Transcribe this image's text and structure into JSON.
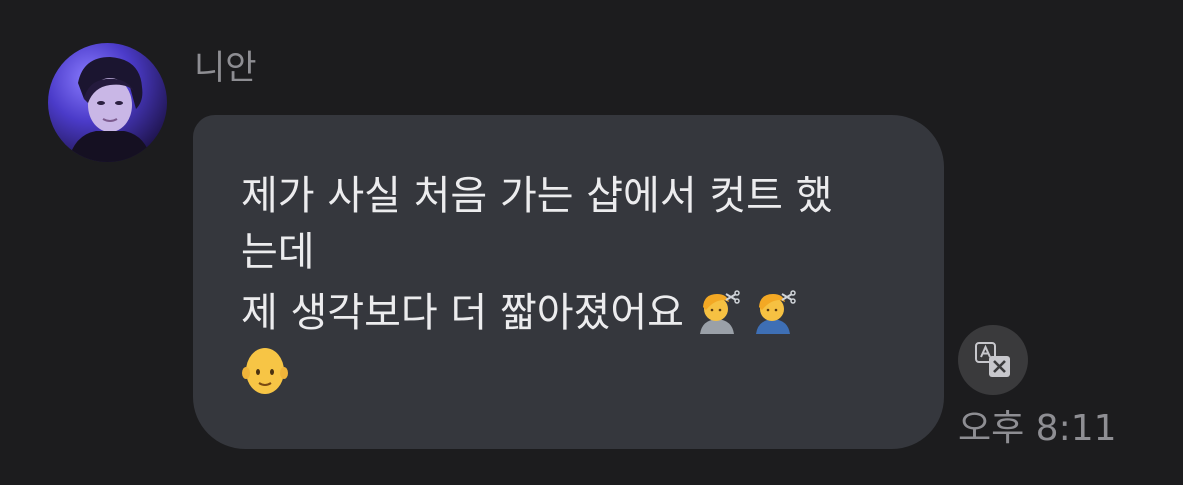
{
  "conversation": {
    "sender": {
      "name": "니안",
      "avatar_icon": "profile-photo"
    },
    "message": {
      "lines": [
        "제가 사실 처음 가는 샵에서 컷트 했",
        "는데",
        "제 생각보다 더 짧아졌어요"
      ],
      "emojis": [
        "person-getting-haircut-emoji",
        "person-getting-haircut-emoji",
        "bald-face-emoji"
      ]
    },
    "translate_icon": "translate-icon",
    "timestamp": "오후 8:11"
  },
  "colors": {
    "background": "#1c1c1e",
    "bubble": "#35373d",
    "message_text": "#ececee",
    "secondary_text": "#8e8e93",
    "translate_button": "#3a3a3c"
  }
}
